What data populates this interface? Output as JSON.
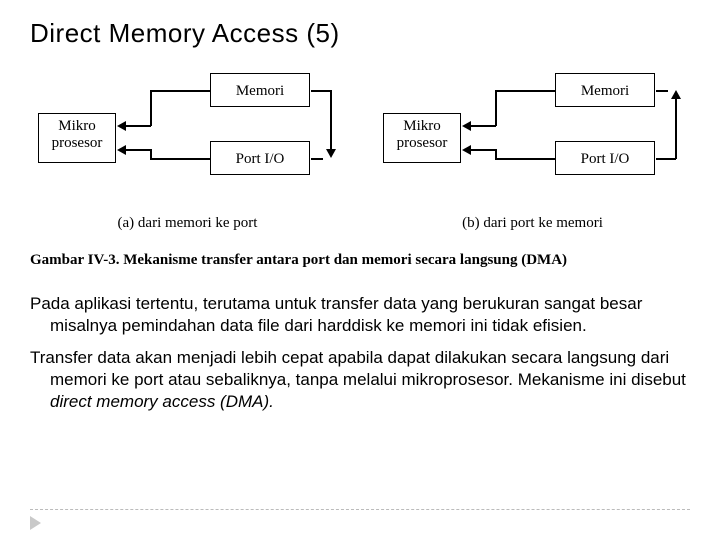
{
  "title": "Direct Memory Access (5)",
  "labels": {
    "micro": "Mikro\nprosesor",
    "memori": "Memori",
    "port": "Port I/O"
  },
  "subcaption_a": "(a) dari memori ke port",
  "subcaption_b": "(b) dari port ke memori",
  "figure_caption": "Gambar IV-3. Mekanisme transfer antara port dan memori secara langsung (DMA)",
  "para1": "Pada aplikasi tertentu, terutama untuk transfer data yang berukuran sangat besar misalnya pemindahan data file dari harddisk ke memori ini tidak efisien.",
  "para2_a": "Transfer data akan menjadi lebih cepat apabila dapat dilakukan secara langsung dari memori ke port atau sebaliknya, tanpa melalui mikroprosesor.  Mekanisme ini disebut ",
  "para2_b": "direct memory access (DMA)."
}
